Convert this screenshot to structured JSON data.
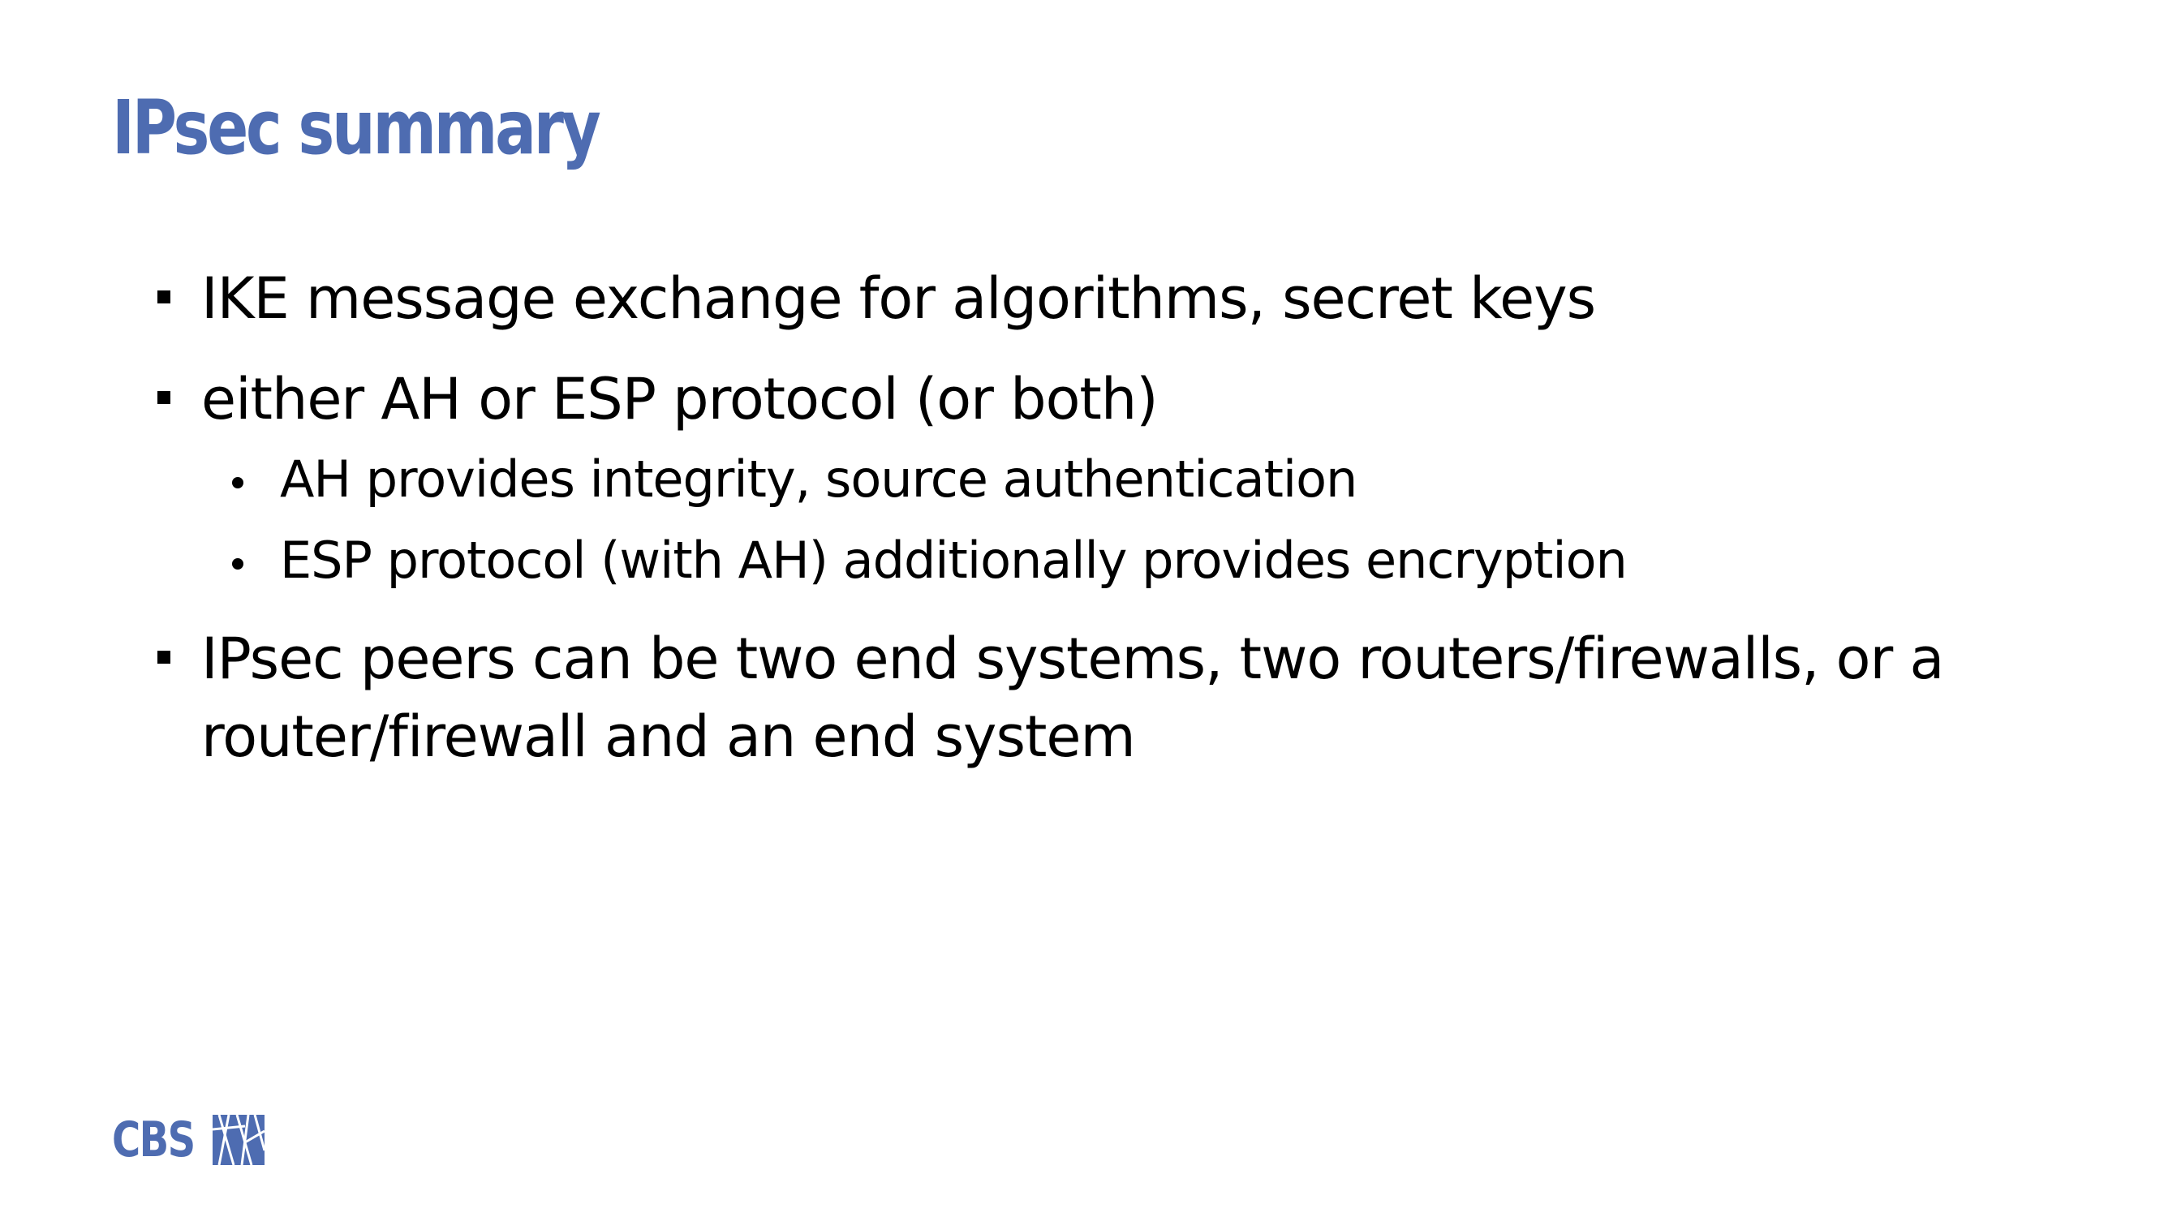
{
  "slide": {
    "title": "IPsec summary",
    "bullets": [
      {
        "text": "IKE message exchange for algorithms, secret keys",
        "subbullets": []
      },
      {
        "text": "either AH or ESP protocol  (or both)",
        "subbullets": [
          "AH provides integrity, source authentication",
          "ESP protocol (with AH) additionally provides encryption"
        ]
      },
      {
        "text": "IPsec peers can be two end systems, two routers/firewalls, or a router/firewall and an end system",
        "subbullets": []
      }
    ]
  },
  "logo": {
    "text": "CBS",
    "icon": "cbs-logo-mark-icon"
  },
  "colors": {
    "accent": "#4e6cb1",
    "text": "#000000",
    "background": "#ffffff"
  }
}
